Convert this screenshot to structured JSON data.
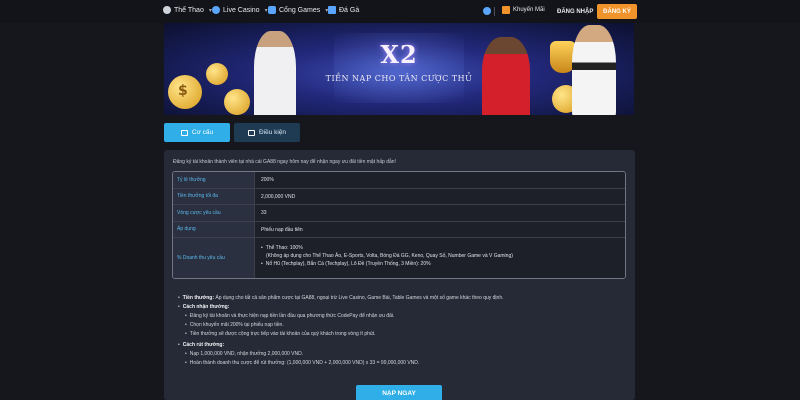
{
  "nav": {
    "items": [
      {
        "label": "Thể Thao",
        "icon": "ball-icon"
      },
      {
        "label": "Live Casino",
        "icon": "chip-icon"
      },
      {
        "label": "Cổng Games",
        "icon": "gamepad-icon"
      },
      {
        "label": "Đá Gà",
        "icon": "rooster-icon"
      }
    ],
    "promo_label": "Khuyến Mãi",
    "login_label": "ĐĂNG NHẬP",
    "register_label": "ĐĂNG KÝ"
  },
  "banner": {
    "headline": "X2",
    "subtitle": "TIỀN NẠP CHO TÂN CƯỢC THỦ"
  },
  "tabs": [
    {
      "label": "Cơ cấu",
      "active": true
    },
    {
      "label": "Điều kiện",
      "active": false
    }
  ],
  "content": {
    "intro": "Đăng ký tài khoản thành viên tại nhà cái GA88 ngay hôm nay để nhận ngay ưu đãi tiền mặt hấp dẫn!",
    "table": [
      {
        "label": "Tỷ lệ thưởng",
        "value": "200%"
      },
      {
        "label": "Tiền thưởng tối đa",
        "value": "2,000,000 VND"
      },
      {
        "label": "Vòng cược yêu cầu",
        "value": "33"
      },
      {
        "label": "Áp dụng",
        "value": "Phiếu nạp đầu tiên"
      }
    ],
    "turnover": {
      "label": "% Doanh thu yêu cầu",
      "line1": "Thể Thao: 100%",
      "line2": "(Không áp dụng cho Thể Thao Ảo, E-Sports, Volta, Bóng Đá GG, Keno, Quay Số, Number Game và V Gaming)",
      "line3": "Nổ Hũ (Techplay), Bắn Cá (Techplay), Lô Đề (Truyền Thống, 3 Miền): 20%"
    },
    "notes": {
      "money_head": "Tiền thưởng:",
      "money_text": "Áp dụng cho tất cả sản phẩm cược tại GA88, ngoại trừ Live Casino, Game Bài, Table Games và một số game khác theo quy định.",
      "how_head": "Cách nhận thưởng:",
      "how_items": [
        "Đăng ký tài khoản và thực hiện nạp tiền lần đầu qua phương thức CodePay để nhận ưu đãi.",
        "Chọn khuyến mãi 200% tại phiếu nạp tiền.",
        "Tiền thưởng sẽ được cộng trực tiếp vào tài khoản của quý khách trong vòng ít phút."
      ],
      "withdraw_head": "Cách rút thưởng:",
      "withdraw_items": [
        "Nạp 1,000,000 VND, nhận thưởng 2,000,000 VND.",
        "Hoàn thành doanh thu cược để rút thưởng: (1,000,000 VND + 2,000,000 VND) x 33 = 99,000,000 VND."
      ]
    },
    "cta_label": "NẠP NGAY"
  },
  "colors": {
    "accent": "#2faee8",
    "register": "#f0932b",
    "panel": "#262a36"
  }
}
